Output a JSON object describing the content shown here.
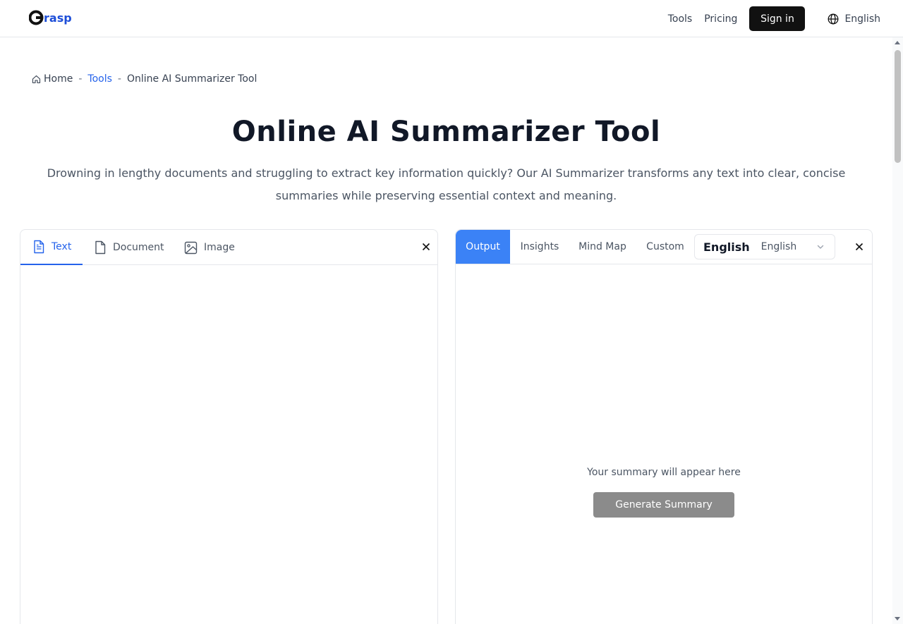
{
  "header": {
    "logo_text": "Grasp",
    "nav": {
      "tools": "Tools",
      "pricing": "Pricing"
    },
    "signin_label": "Sign in",
    "language": "English"
  },
  "breadcrumb": {
    "home": "Home",
    "tools": "Tools",
    "current": "Online AI Summarizer Tool",
    "separator": "-"
  },
  "hero": {
    "title": "Online AI Summarizer Tool",
    "subtitle": "Drowning in lengthy documents and struggling to extract key information quickly? Our AI Summarizer transforms any text into clear, concise summaries while preserving essential context and meaning."
  },
  "input_panel": {
    "tabs": [
      {
        "label": "Text",
        "icon": "file-text-icon",
        "active": true
      },
      {
        "label": "Document",
        "icon": "file-icon",
        "active": false
      },
      {
        "label": "Image",
        "icon": "image-icon",
        "active": false
      }
    ],
    "close_icon": "close-icon"
  },
  "output_panel": {
    "tabs": [
      {
        "label": "Output",
        "active": true
      },
      {
        "label": "Insights",
        "active": false
      },
      {
        "label": "Mind Map",
        "active": false
      },
      {
        "label": "Custom",
        "active": false
      }
    ],
    "language_select": {
      "selected_bold": "English",
      "selected": "English"
    },
    "placeholder": "Your summary will appear here",
    "generate_label": "Generate Summary"
  },
  "colors": {
    "accent": "#3b82f6",
    "link": "#2563eb",
    "signin_bg": "#111111",
    "generate_bg": "#8b8b8b"
  }
}
